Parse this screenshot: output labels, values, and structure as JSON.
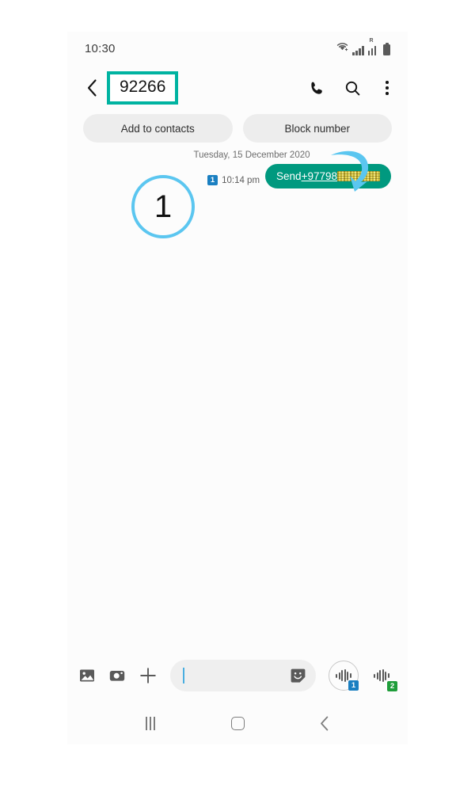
{
  "status_bar": {
    "time": "10:30",
    "icons": [
      "wifi-icon",
      "signal-icon",
      "signal-roaming-icon",
      "battery-icon"
    ],
    "roaming_label": "R"
  },
  "app_bar": {
    "back_icon": "back-chevron-icon",
    "title": "92266",
    "title_highlight_color": "#00b3a1",
    "actions": [
      {
        "name": "call-button",
        "icon": "phone-icon"
      },
      {
        "name": "search-button",
        "icon": "search-icon"
      },
      {
        "name": "more-options-button",
        "icon": "overflow-menu-icon"
      }
    ]
  },
  "quick_actions": {
    "add_to_contacts_label": "Add to contacts",
    "block_number_label": "Block number"
  },
  "conversation": {
    "date_label": "Tuesday, 15 December 2020",
    "messages": [
      {
        "sim_badge": "1",
        "sim_badge_color": "#1a7fc1",
        "time": "10:14 pm",
        "text_prefix": "Send ",
        "link_text": "+97798",
        "redacted": true,
        "bubble_color": "#00997f"
      }
    ]
  },
  "annotations": {
    "step_number": "1",
    "circle_color": "#5bc6f0",
    "arrow_color": "#5bc6f0"
  },
  "composer": {
    "placeholder": "",
    "value": "",
    "attachments": [
      {
        "name": "gallery-button",
        "icon": "image-icon"
      },
      {
        "name": "camera-button",
        "icon": "camera-icon"
      },
      {
        "name": "more-attachments-button",
        "icon": "plus-icon"
      }
    ],
    "sticker_icon": "sticker-icon",
    "send_buttons": [
      {
        "name": "send-sim1-button",
        "icon": "voice-waveform-icon",
        "badge": "1",
        "badge_color": "#1a7fc1",
        "selected": true
      },
      {
        "name": "send-sim2-button",
        "icon": "voice-waveform-icon",
        "badge": "2",
        "badge_color": "#1f9d3a",
        "selected": false
      }
    ]
  },
  "nav_bar": {
    "recents_icon": "recents-icon",
    "home_icon": "home-icon",
    "back_icon": "back-icon"
  }
}
